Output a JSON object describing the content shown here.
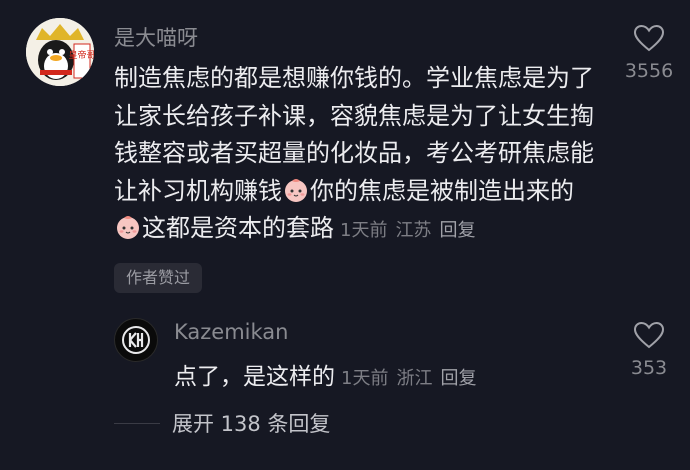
{
  "comment": {
    "username": "是大喵呀",
    "text_1": "制造焦虑的都是想赚你钱的。学业焦虑是为了让家长给孩子补课，容貌焦虑是为了让女生掏钱整容或者买超量的化妆品，考公考研焦虑能让补习机构赚钱",
    "text_2": "你的焦虑是被制造出来的",
    "text_3": "这都是资本的套路",
    "time": "1天前",
    "location": "江苏",
    "reply_label": "回复",
    "author_badge": "作者赞过",
    "like_count": "3556",
    "avatar_text": "皇帝哥",
    "emoji_name": "peach-face-icon"
  },
  "reply": {
    "username": "Kazemikan",
    "text": "点了，是这样的",
    "time": "1天前",
    "location": "浙江",
    "reply_label": "回复",
    "like_count": "353"
  },
  "expand": {
    "label": "展开 138 条回复"
  },
  "colors": {
    "background": "#161823",
    "primary_text": "#ececef",
    "secondary_text": "#8a8b91"
  }
}
